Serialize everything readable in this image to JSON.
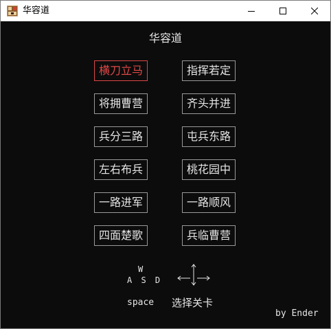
{
  "window": {
    "title": "华容道",
    "icon": "huarongdao-app-icon"
  },
  "game": {
    "heading": "华容道",
    "levels": [
      {
        "label": "横刀立马",
        "selected": true
      },
      {
        "label": "指挥若定",
        "selected": false
      },
      {
        "label": "将拥曹营",
        "selected": false
      },
      {
        "label": "齐头并进",
        "selected": false
      },
      {
        "label": "兵分三路",
        "selected": false
      },
      {
        "label": "屯兵东路",
        "selected": false
      },
      {
        "label": "左右布兵",
        "selected": false
      },
      {
        "label": "桃花园中",
        "selected": false
      },
      {
        "label": "一路进军",
        "selected": false
      },
      {
        "label": "一路顺风",
        "selected": false
      },
      {
        "label": "四面楚歌",
        "selected": false
      },
      {
        "label": "兵临曹营",
        "selected": false
      }
    ],
    "controls": {
      "key_up": "W",
      "keys_row": "A S D",
      "space": "space",
      "select_hint": "选择关卡"
    },
    "credit": "by Ender"
  },
  "colors": {
    "background": "#0c0c0c",
    "text": "#e6e6e6",
    "button_border": "#9a9a9a",
    "selected": "#e04848"
  }
}
